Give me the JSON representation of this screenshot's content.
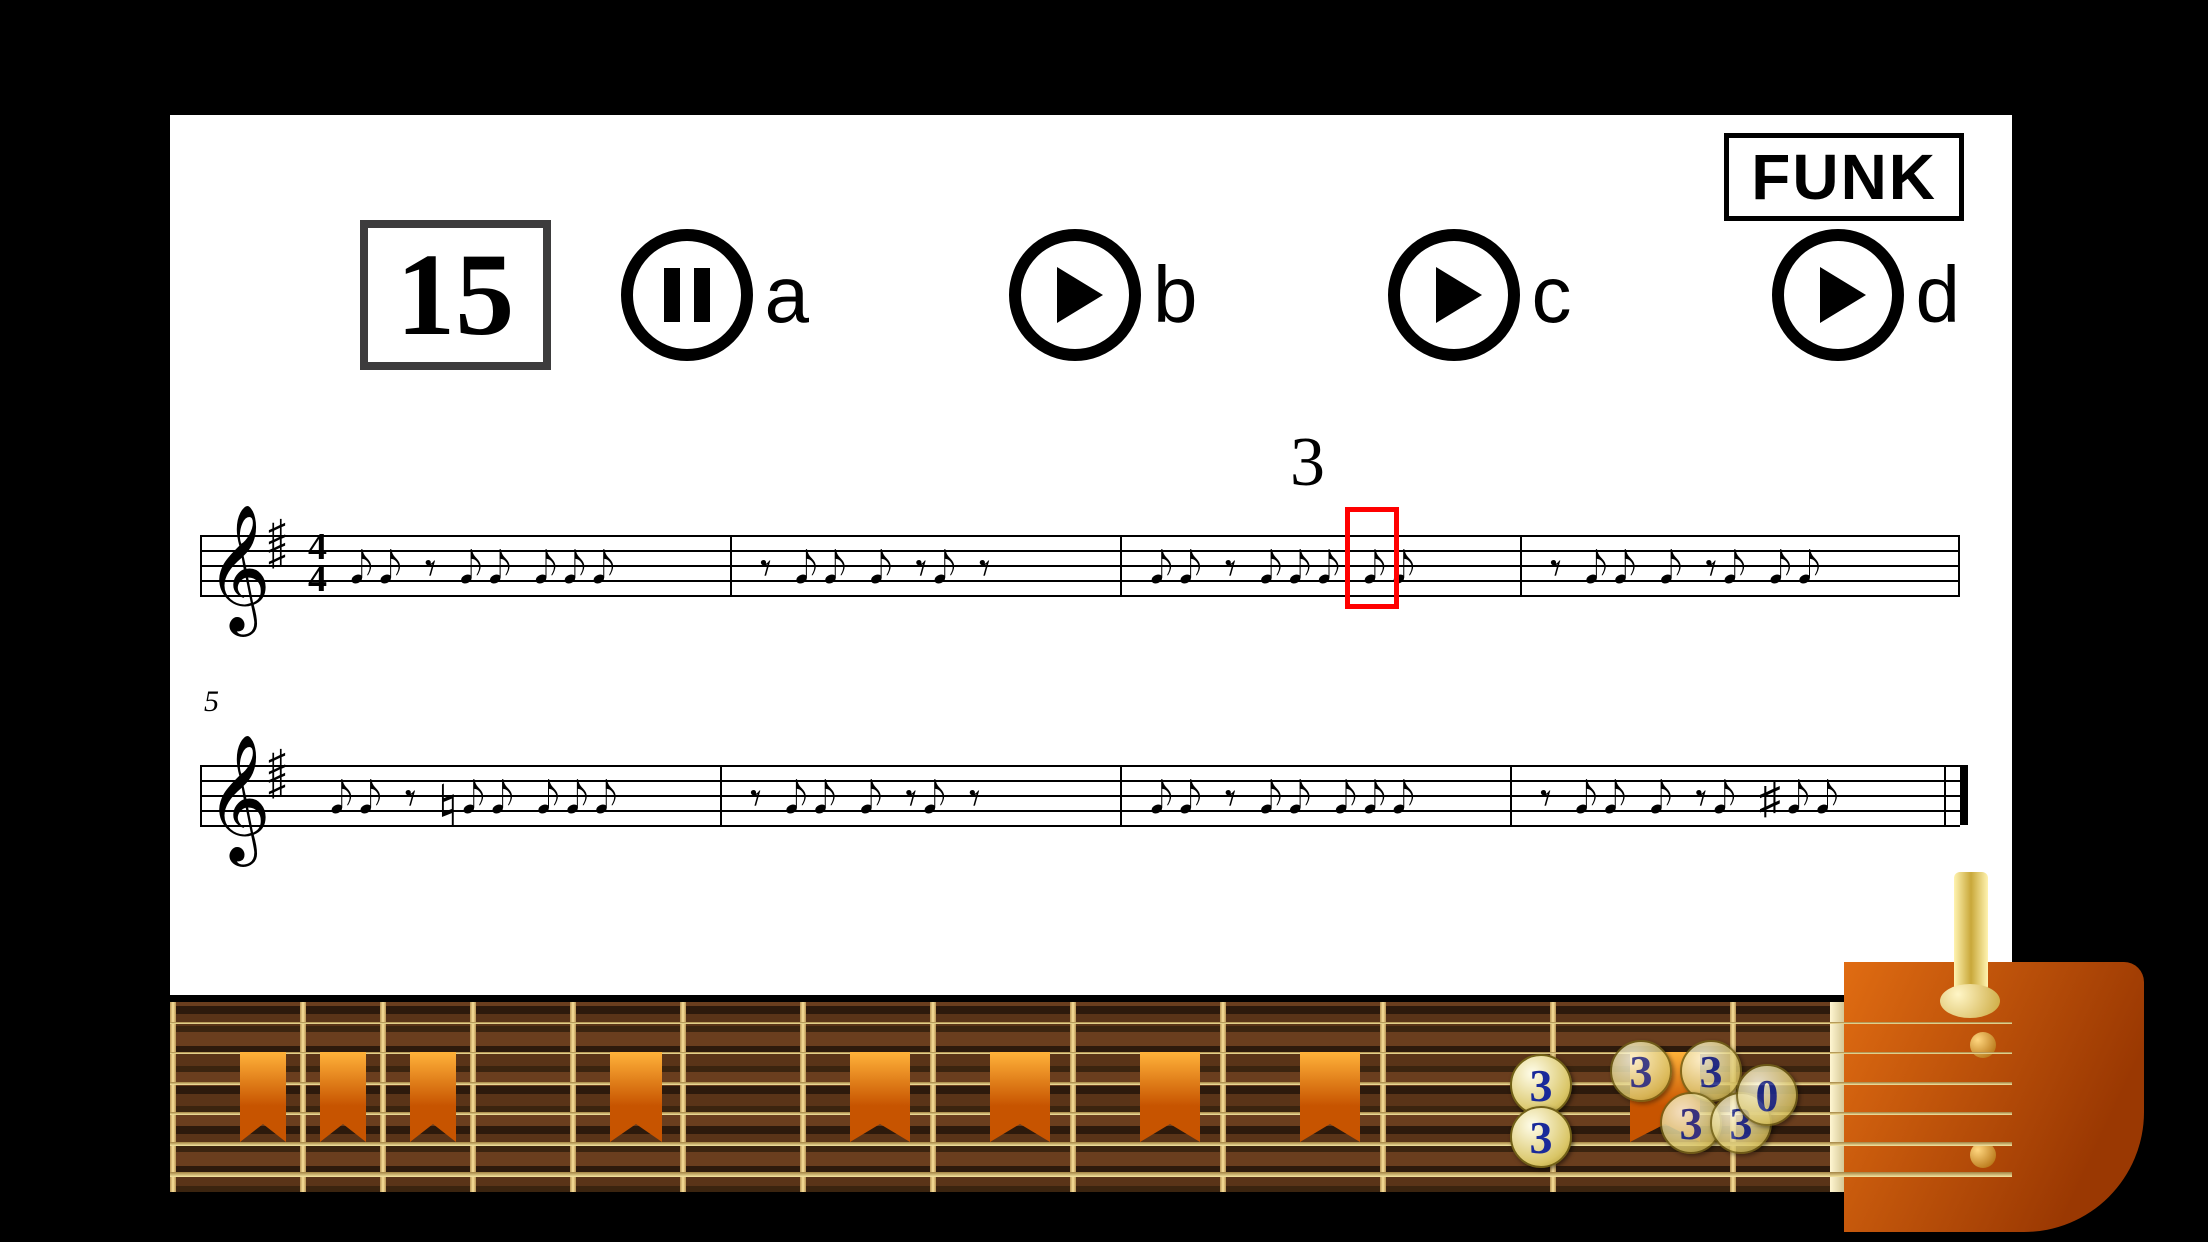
{
  "style": "FUNK",
  "exercise_number": "15",
  "triplet_marker": "3",
  "bar_number_line2": "5",
  "timesig": {
    "top": "4",
    "bottom": "4"
  },
  "controls": {
    "a": {
      "label": "a",
      "state": "pause"
    },
    "b": {
      "label": "b",
      "state": "play"
    },
    "c": {
      "label": "c",
      "state": "play"
    },
    "d": {
      "label": "d",
      "state": "play"
    }
  },
  "fingers": {
    "main1": "3",
    "main2": "3",
    "ghost1": "3",
    "ghost2": "3",
    "ghost3": "3",
    "ghost4": "3",
    "ghost5": "0"
  }
}
